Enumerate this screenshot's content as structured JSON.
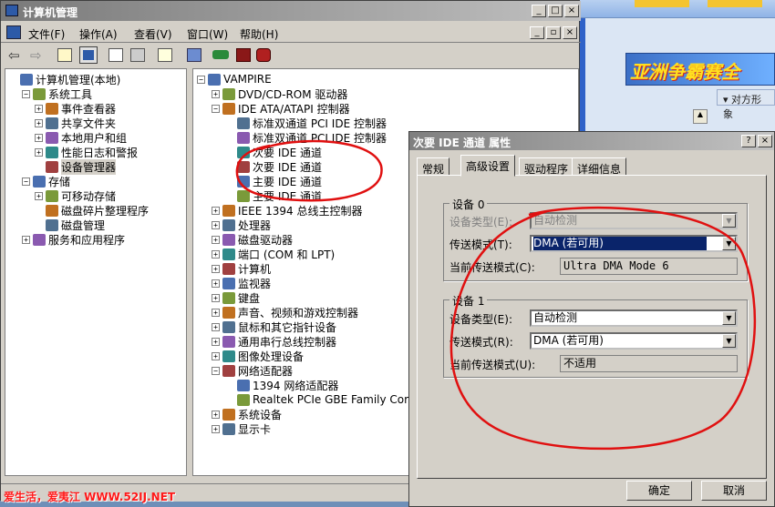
{
  "main_window": {
    "title": "计算机管理",
    "menus": [
      "文件(F)",
      "操作(A)",
      "查看(V)",
      "窗口(W)",
      "帮助(H)"
    ]
  },
  "left_tree": [
    {
      "label": "计算机管理(本地)",
      "expander": "",
      "depth": 0
    },
    {
      "label": "系统工具",
      "expander": "−",
      "depth": 1
    },
    {
      "label": "事件查看器",
      "expander": "+",
      "depth": 2
    },
    {
      "label": "共享文件夹",
      "expander": "+",
      "depth": 2
    },
    {
      "label": "本地用户和组",
      "expander": "+",
      "depth": 2
    },
    {
      "label": "性能日志和警报",
      "expander": "+",
      "depth": 2
    },
    {
      "label": "设备管理器",
      "expander": "",
      "depth": 2
    },
    {
      "label": "存储",
      "expander": "−",
      "depth": 1
    },
    {
      "label": "可移动存储",
      "expander": "+",
      "depth": 2
    },
    {
      "label": "磁盘碎片整理程序",
      "expander": "",
      "depth": 2
    },
    {
      "label": "磁盘管理",
      "expander": "",
      "depth": 2
    },
    {
      "label": "服务和应用程序",
      "expander": "+",
      "depth": 1
    }
  ],
  "right_tree": [
    {
      "label": "VAMPIRE",
      "expander": "−",
      "depth": 0
    },
    {
      "label": "DVD/CD-ROM 驱动器",
      "expander": "+",
      "depth": 1
    },
    {
      "label": "IDE ATA/ATAPI 控制器",
      "expander": "−",
      "depth": 1
    },
    {
      "label": "标准双通道 PCI IDE 控制器",
      "expander": "",
      "depth": 2
    },
    {
      "label": "标准双通道 PCI IDE 控制器",
      "expander": "",
      "depth": 2
    },
    {
      "label": "次要 IDE 通道",
      "expander": "",
      "depth": 2
    },
    {
      "label": "次要 IDE 通道",
      "expander": "",
      "depth": 2
    },
    {
      "label": "主要 IDE 通道",
      "expander": "",
      "depth": 2
    },
    {
      "label": "主要 IDE 通道",
      "expander": "",
      "depth": 2
    },
    {
      "label": "IEEE 1394 总线主控制器",
      "expander": "+",
      "depth": 1
    },
    {
      "label": "处理器",
      "expander": "+",
      "depth": 1
    },
    {
      "label": "磁盘驱动器",
      "expander": "+",
      "depth": 1
    },
    {
      "label": "端口 (COM 和 LPT)",
      "expander": "+",
      "depth": 1
    },
    {
      "label": "计算机",
      "expander": "+",
      "depth": 1
    },
    {
      "label": "监视器",
      "expander": "+",
      "depth": 1
    },
    {
      "label": "键盘",
      "expander": "+",
      "depth": 1
    },
    {
      "label": "声音、视频和游戏控制器",
      "expander": "+",
      "depth": 1
    },
    {
      "label": "鼠标和其它指针设备",
      "expander": "+",
      "depth": 1
    },
    {
      "label": "通用串行总线控制器",
      "expander": "+",
      "depth": 1
    },
    {
      "label": "图像处理设备",
      "expander": "+",
      "depth": 1
    },
    {
      "label": "网络适配器",
      "expander": "−",
      "depth": 1
    },
    {
      "label": "1394 网络适配器",
      "expander": "",
      "depth": 2
    },
    {
      "label": "Realtek PCIe GBE Family Cor",
      "expander": "",
      "depth": 2
    },
    {
      "label": "系统设备",
      "expander": "+",
      "depth": 1
    },
    {
      "label": "显示卡",
      "expander": "+",
      "depth": 1
    }
  ],
  "dialog": {
    "title": "次要 IDE 通道 属性",
    "help_btn": "?",
    "close_btn": "×",
    "tabs": [
      "常规",
      "高级设置",
      "驱动程序",
      "详细信息"
    ],
    "device0": {
      "group_label": "设备 0",
      "type_label": "设备类型(E):",
      "type_value": "自动检测",
      "transfer_label": "传送模式(T):",
      "transfer_value": "DMA (若可用)",
      "current_label": "当前传送模式(C):",
      "current_value": "Ultra DMA Mode 6"
    },
    "device1": {
      "group_label": "设备 1",
      "type_label": "设备类型(E):",
      "type_value": "自动检测",
      "transfer_label": "传送模式(R):",
      "transfer_value": "DMA (若可用)",
      "current_label": "当前传送模式(U):",
      "current_value": "不适用"
    },
    "ok": "确定",
    "cancel": "取消"
  },
  "background_browser": {
    "banner": "亚洲争霸赛全",
    "panel_title": "对方形象"
  },
  "watermark": "爱生活，爱夷江 WWW.52IJ.NET"
}
